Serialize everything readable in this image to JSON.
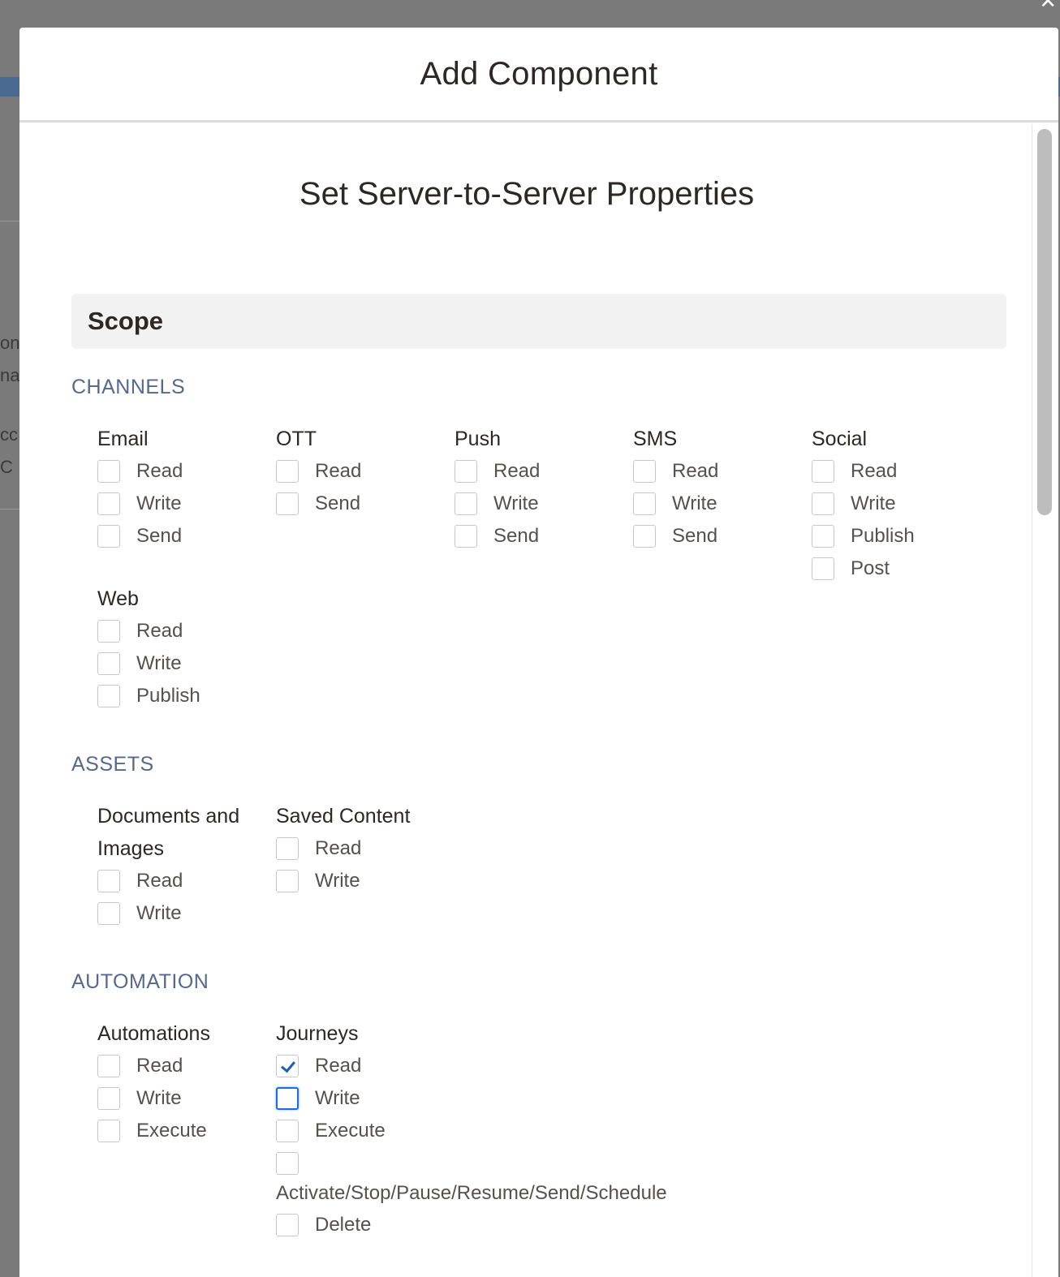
{
  "modal": {
    "title": "Add Component"
  },
  "page": {
    "heading": "Set Server-to-Server Properties",
    "scope_label": "Scope"
  },
  "sections": {
    "channels": {
      "title": "CHANNELS",
      "groups": [
        {
          "name": "Email",
          "options": [
            {
              "label": "Read",
              "checked": false
            },
            {
              "label": "Write",
              "checked": false
            },
            {
              "label": "Send",
              "checked": false
            }
          ]
        },
        {
          "name": "OTT",
          "options": [
            {
              "label": "Read",
              "checked": false
            },
            {
              "label": "Send",
              "checked": false
            }
          ]
        },
        {
          "name": "Push",
          "options": [
            {
              "label": "Read",
              "checked": false
            },
            {
              "label": "Write",
              "checked": false
            },
            {
              "label": "Send",
              "checked": false
            }
          ]
        },
        {
          "name": "SMS",
          "options": [
            {
              "label": "Read",
              "checked": false
            },
            {
              "label": "Write",
              "checked": false
            },
            {
              "label": "Send",
              "checked": false
            }
          ]
        },
        {
          "name": "Social",
          "options": [
            {
              "label": "Read",
              "checked": false
            },
            {
              "label": "Write",
              "checked": false
            },
            {
              "label": "Publish",
              "checked": false
            },
            {
              "label": "Post",
              "checked": false
            }
          ]
        },
        {
          "name": "Web",
          "options": [
            {
              "label": "Read",
              "checked": false
            },
            {
              "label": "Write",
              "checked": false
            },
            {
              "label": "Publish",
              "checked": false
            }
          ]
        }
      ]
    },
    "assets": {
      "title": "ASSETS",
      "groups": [
        {
          "name": "Documents and Images",
          "options": [
            {
              "label": "Read",
              "checked": false
            },
            {
              "label": "Write",
              "checked": false
            }
          ]
        },
        {
          "name": "Saved Content",
          "options": [
            {
              "label": "Read",
              "checked": false
            },
            {
              "label": "Write",
              "checked": false
            }
          ]
        }
      ]
    },
    "automation": {
      "title": "AUTOMATION",
      "groups": [
        {
          "name": "Automations",
          "options": [
            {
              "label": "Read",
              "checked": false
            },
            {
              "label": "Write",
              "checked": false
            },
            {
              "label": "Execute",
              "checked": false
            }
          ]
        },
        {
          "name": "Journeys",
          "options": [
            {
              "label": "Read",
              "checked": true
            },
            {
              "label": "Write",
              "checked": false,
              "focused": true
            },
            {
              "label": "Execute",
              "checked": false
            },
            {
              "label": "Activate/Stop/Pause/Resume/Send/Schedule",
              "checked": false
            },
            {
              "label": "Delete",
              "checked": false
            }
          ]
        }
      ]
    }
  },
  "background": {
    "fragments": [
      "on",
      "na",
      "cc",
      "C"
    ]
  },
  "colors": {
    "accent": "#1b5fb4",
    "section_title": "#54698d",
    "overlay": "#7a7a7a"
  }
}
